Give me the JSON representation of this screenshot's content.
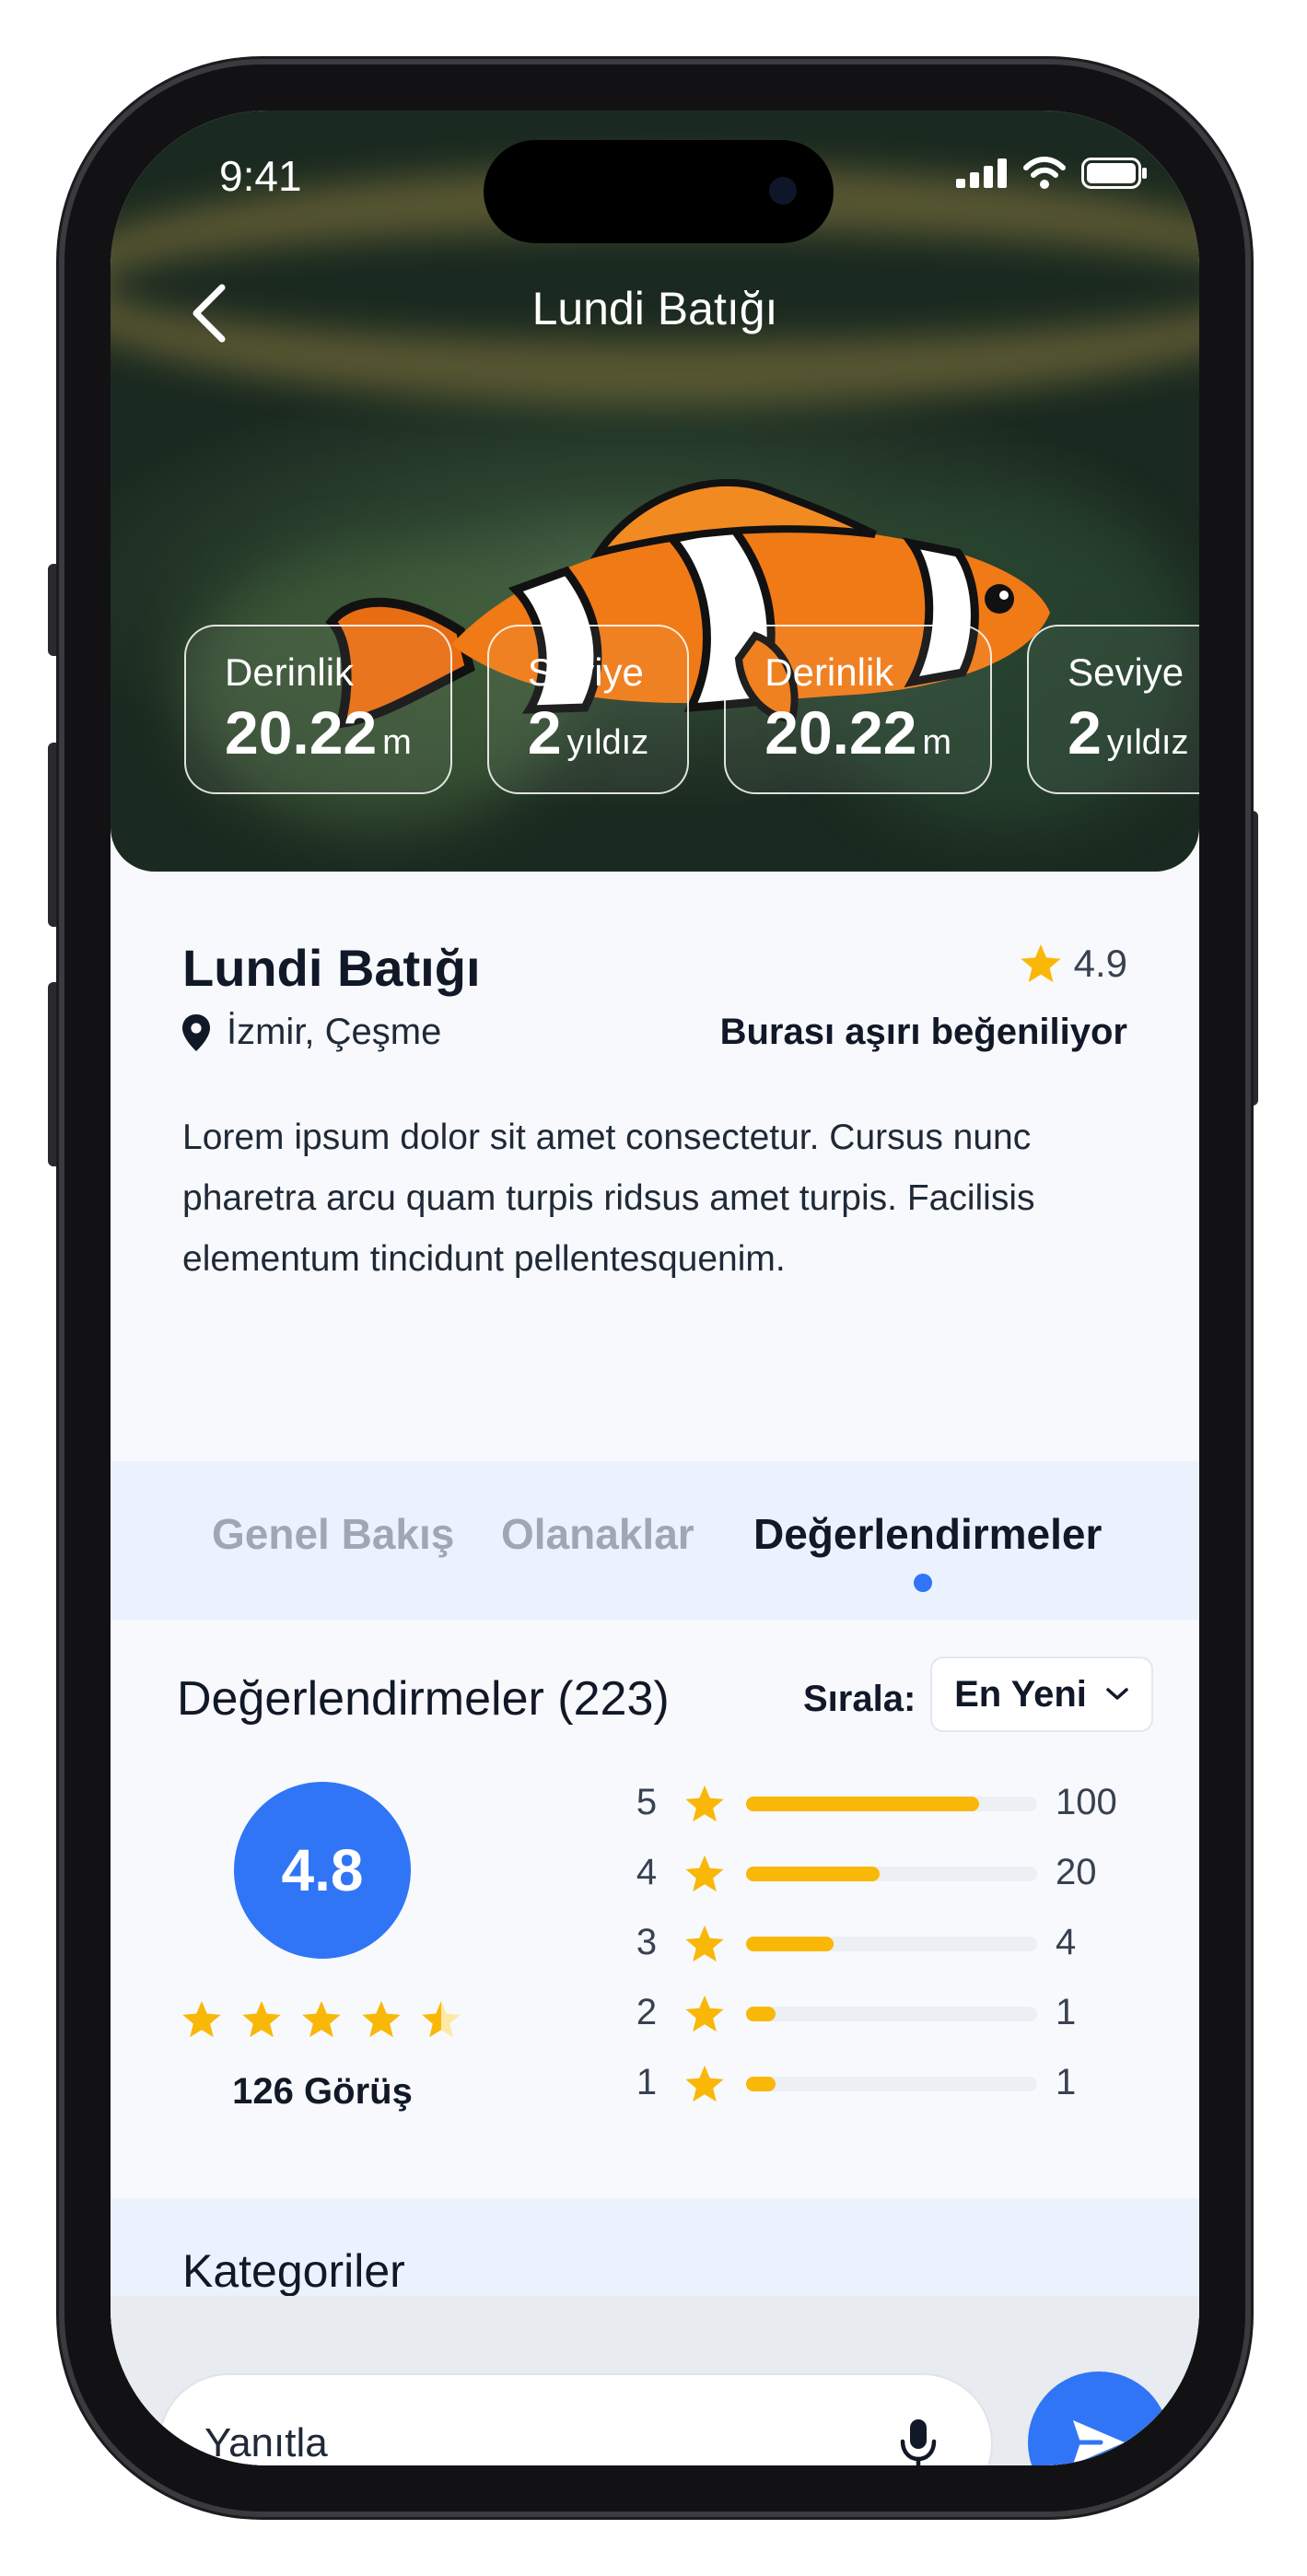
{
  "status_bar": {
    "time": "9:41"
  },
  "header": {
    "title": "Lundi Batığı"
  },
  "stats": [
    {
      "label": "Derinlik",
      "value": "20.22",
      "unit": "m"
    },
    {
      "label": "Seviye",
      "value": "2",
      "unit": "yıldız"
    },
    {
      "label": "Derinlik",
      "value": "20.22",
      "unit": "m"
    },
    {
      "label": "Seviye",
      "value": "2",
      "unit": "yıldız"
    }
  ],
  "place": {
    "name": "Lundi Batığı",
    "rating": "4.9",
    "location": "İzmir, Çeşme",
    "liked_text": "Burası aşırı beğeniliyor",
    "description": "Lorem ipsum dolor sit amet consectetur. Cursus nunc pharetra arcu quam turpis ridsus amet turpis. Facilisis elementum tincidunt pellentesquenim."
  },
  "tabs": [
    {
      "label": "Genel Bakış",
      "active": false
    },
    {
      "label": "Olanaklar",
      "active": false
    },
    {
      "label": "Değerlendirmeler",
      "active": true
    }
  ],
  "reviews": {
    "title": "Değerlendirmeler (223)",
    "sort_label": "Sırala:",
    "sort_value": "En Yeni",
    "average": "4.8",
    "average_stars": 4.5,
    "views": "126 Görüş",
    "rows": [
      {
        "stars": "5",
        "count": "100",
        "fill": 0.8
      },
      {
        "stars": "4",
        "count": "20",
        "fill": 0.46
      },
      {
        "stars": "3",
        "count": "4",
        "fill": 0.3
      },
      {
        "stars": "2",
        "count": "1",
        "fill": 0.1
      },
      {
        "stars": "1",
        "count": "1",
        "fill": 0.1
      }
    ]
  },
  "categories": {
    "title": "Kategoriler"
  },
  "reply": {
    "placeholder": "Yanıtla"
  },
  "colors": {
    "accent": "#2f75f6",
    "star": "#f9b708",
    "tab_bg": "#ecf2fd"
  }
}
